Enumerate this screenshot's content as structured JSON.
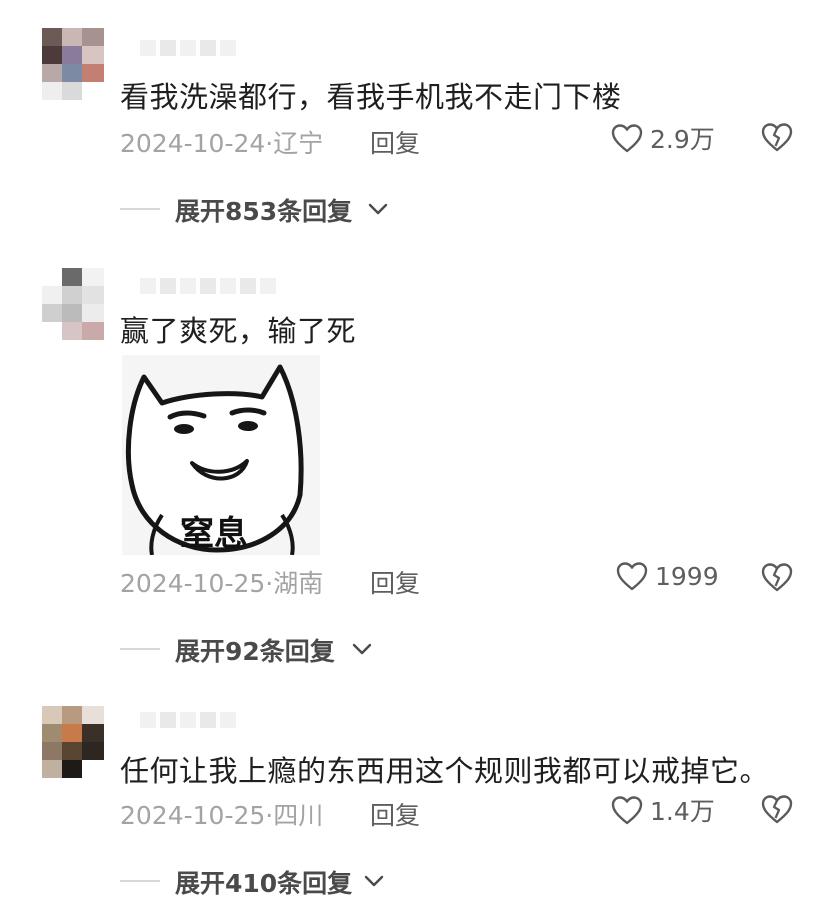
{
  "comments": [
    {
      "text": "看我洗澡都行，看我手机我不走门下楼",
      "date": "2024-10-24·辽宁",
      "reply_label": "回复",
      "likes": "2.9万",
      "expand_label": "展开853条回复"
    },
    {
      "text": "赢了爽死，输了死",
      "sticker_caption": "窒息",
      "date": "2024-10-25·湖南",
      "reply_label": "回复",
      "likes": "1999",
      "expand_label": "展开92条回复"
    },
    {
      "text": "任何让我上瘾的东西用这个规则我都可以戒掉它。",
      "date": "2024-10-25·四川",
      "reply_label": "回复",
      "likes": "1.4万",
      "expand_label": "展开410条回复"
    }
  ],
  "icons": {
    "like": "heart-outline-icon",
    "dislike": "broken-heart-icon",
    "expand": "chevron-down-icon"
  },
  "colors": {
    "meta_text": "#a3a3a3",
    "reply_text": "#5e5e5e",
    "body_text": "#1f1f1f"
  }
}
